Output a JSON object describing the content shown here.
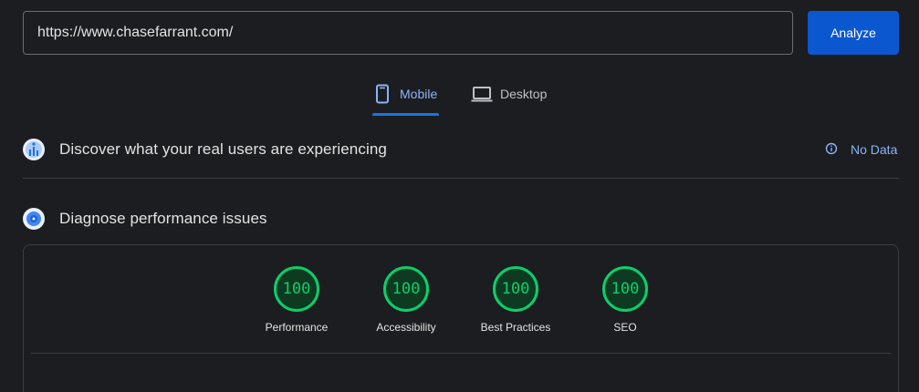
{
  "url_bar": {
    "value": "https://www.chasefarrant.com/"
  },
  "analyze_button": {
    "label": "Analyze"
  },
  "tabs": [
    {
      "label": "Mobile",
      "icon": "phone-icon",
      "selected": true
    },
    {
      "label": "Desktop",
      "icon": "laptop-icon",
      "selected": false
    }
  ],
  "field_data": {
    "title": "Discover what your real users are experiencing",
    "status": "No Data",
    "status_icon": "info-icon"
  },
  "lab_data": {
    "title": "Diagnose performance issues",
    "scores": [
      {
        "label": "Performance",
        "value": "100"
      },
      {
        "label": "Accessibility",
        "value": "100"
      },
      {
        "label": "Best Practices",
        "value": "100"
      },
      {
        "label": "SEO",
        "value": "100"
      }
    ]
  },
  "colors": {
    "accent": "#8ab4f8",
    "button": "#0b57d0",
    "score_good": "#0cce6b",
    "background": "#1c1d20"
  }
}
